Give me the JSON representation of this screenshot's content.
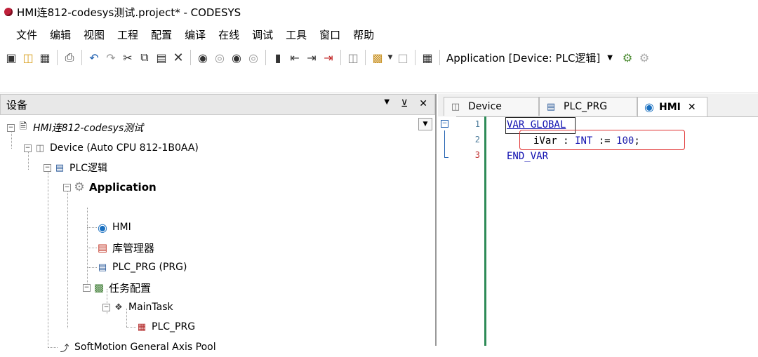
{
  "window": {
    "title": "HMI连812-codesys测试.project* - CODESYS"
  },
  "menu": [
    "文件",
    "编辑",
    "视图",
    "工程",
    "配置",
    "编译",
    "在线",
    "调试",
    "工具",
    "窗口",
    "帮助"
  ],
  "toolbar": {
    "application_label": "Application [Device: PLC逻辑]"
  },
  "devices_panel": {
    "title": "设备",
    "tree": {
      "project": "HMI连812-codesys测试",
      "device": "Device (Auto CPU 812-1B0AA)",
      "plc_logic": "PLC逻辑",
      "application": "Application",
      "hmi": "HMI",
      "library_manager": "库管理器",
      "plc_prg": "PLC_PRG (PRG)",
      "task_config": "任务配置",
      "main_task": "MainTask",
      "task_plc_prg": "PLC_PRG",
      "softmotion": "SoftMotion General Axis Pool"
    }
  },
  "editor": {
    "tabs": [
      {
        "label": "Device"
      },
      {
        "label": "PLC_PRG"
      },
      {
        "label": "HMI"
      }
    ],
    "lines": [
      {
        "num": "1",
        "kw": "VAR_GLOBAL"
      },
      {
        "num": "2",
        "ident": "iVar",
        "colon": " : ",
        "type": "INT",
        "assign": " := ",
        "value": "100",
        "semi": ";"
      },
      {
        "num": "3",
        "kw": "END_VAR"
      }
    ]
  }
}
